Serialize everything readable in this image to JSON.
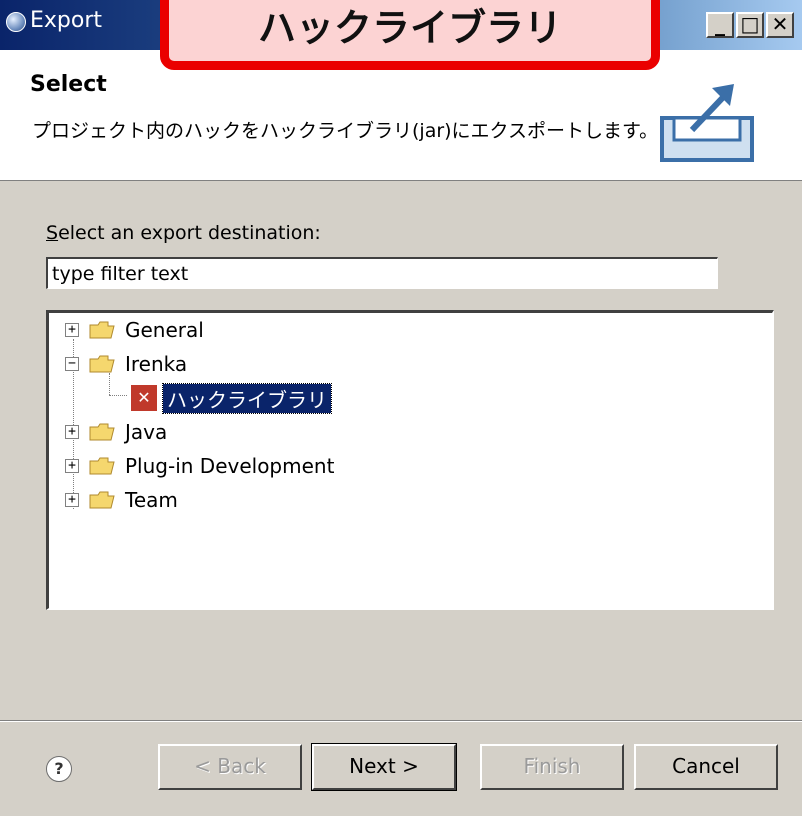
{
  "window": {
    "title": "Export",
    "title_icon": "eclipse-icon",
    "controls": {
      "minimize": "_",
      "maximize": "□",
      "close": "✕"
    }
  },
  "callout": {
    "text": "ハックライブラリ"
  },
  "header": {
    "title": "Select",
    "description": "プロジェクト内のハックをハックライブラリ(jar)にエクスポートします。",
    "icon": "export-icon"
  },
  "destination": {
    "label_prefix": "S",
    "label_rest": "elect an export destination:",
    "filter_value": "type filter text"
  },
  "tree": {
    "items": [
      {
        "label": "General",
        "expander": "+",
        "icon": "folder-icon"
      },
      {
        "label": "Irenka",
        "expander": "−",
        "icon": "folder-icon"
      },
      {
        "label": "ハックライブラリ",
        "icon": "hack-library-icon",
        "selected": true
      },
      {
        "label": "Java",
        "expander": "+",
        "icon": "folder-icon"
      },
      {
        "label": "Plug-in Development",
        "expander": "+",
        "icon": "folder-icon"
      },
      {
        "label": "Team",
        "expander": "+",
        "icon": "folder-icon"
      }
    ]
  },
  "buttons": {
    "help": "?",
    "back": "< Back",
    "next": "Next >",
    "finish": "Finish",
    "cancel": "Cancel"
  },
  "colors": {
    "callout_border": "#ea0000",
    "callout_fill": "#fcd3d3",
    "selection": "#0a246a",
    "titlebar": "#0a246a"
  }
}
